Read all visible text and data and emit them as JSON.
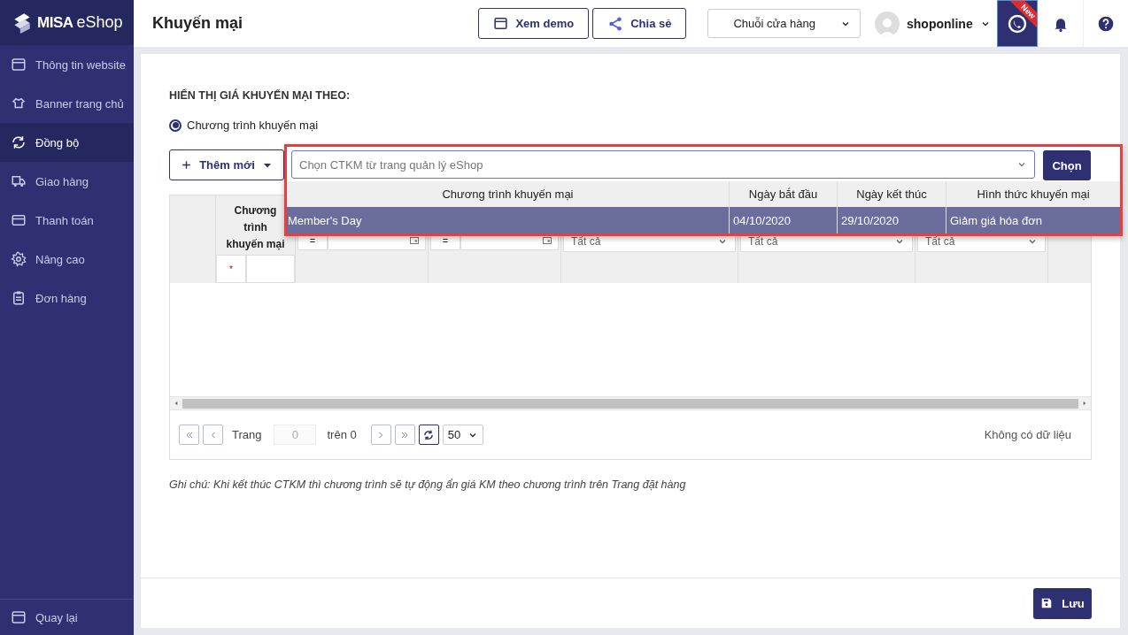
{
  "sidebar": {
    "logo_brand": "MISA",
    "logo_product": "eShop",
    "items": [
      {
        "label": "Thông tin website",
        "selected": false
      },
      {
        "label": "Banner trang chủ",
        "selected": false
      },
      {
        "label": "Đồng bộ",
        "selected": true
      },
      {
        "label": "Giao hàng",
        "selected": false
      },
      {
        "label": "Thanh toán",
        "selected": false
      },
      {
        "label": "Nâng cao",
        "selected": false
      },
      {
        "label": "Đơn hàng",
        "selected": false
      }
    ],
    "back": "Quay lại"
  },
  "header": {
    "title": "Khuyến mại",
    "demo_button": "Xem demo",
    "share_button": "Chia sẻ",
    "store_select": "Chuỗi cửa hàng",
    "user": "shoponline",
    "new_badge": "New"
  },
  "display_setting": {
    "heading": "HIỂN THỊ GIÁ KHUYẾN MẠI THEO:",
    "radio": {
      "label": "Chương trình khuyến mại",
      "selected": true
    }
  },
  "toolbar": {
    "add_button": "Thêm mới",
    "promo_select": {
      "placeholder": "Chọn CTKM từ trang quản lý eShop",
      "expanded": true
    },
    "choose_button": "Chọn"
  },
  "dropdown": {
    "columns": [
      "Chương trình khuyến mại",
      "Ngày bắt đầu",
      "Ngày kết thúc",
      "Hình thức khuyến mại"
    ],
    "rows": [
      {
        "cells": [
          "Member's Day",
          "04/10/2020",
          "29/10/2020",
          "Giảm giá hóa đơn"
        ],
        "selected": true
      }
    ]
  },
  "grid": {
    "header": "Chương trình khuyến mại",
    "new_row_marker": "*",
    "filters": [
      {
        "kind": "date",
        "operator": "="
      },
      {
        "kind": "date",
        "operator": "="
      },
      {
        "kind": "select",
        "value": "Tất cả"
      },
      {
        "kind": "select",
        "value": "Tất cả"
      },
      {
        "kind": "select",
        "value": "Tất cả"
      },
      {
        "kind": "empty"
      }
    ]
  },
  "pager": {
    "label": "Trang",
    "page": "0",
    "of": "trên 0",
    "page_size": "50",
    "status": "Không có dữ liệu"
  },
  "note": "Ghi chú: Khi kết thúc CTKM thì chương trình sẽ tự động ẩn giá KM theo chương trình trên Trang đặt hàng",
  "save_button": "Lưu"
}
